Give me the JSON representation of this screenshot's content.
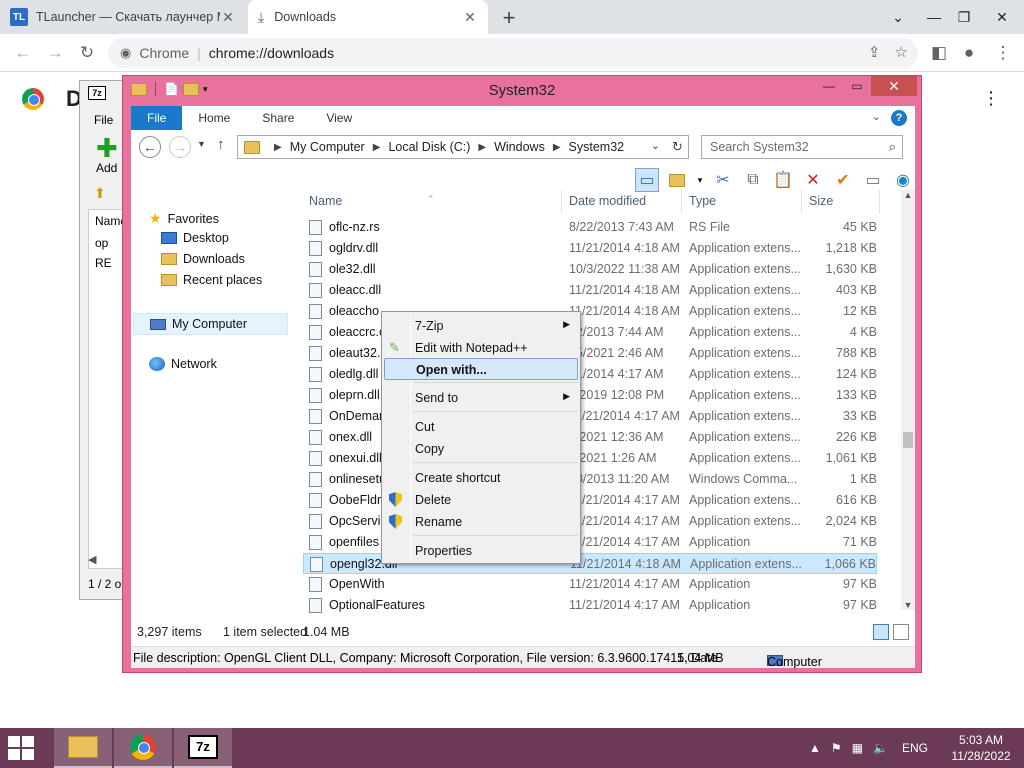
{
  "browser": {
    "tabs": [
      {
        "title": "TLauncher — Скачать лаунчер M",
        "favicon": "TL"
      },
      {
        "title": "Downloads"
      }
    ],
    "omnibox": {
      "origin": "Chrome",
      "url": "chrome://downloads"
    },
    "page_letter": "D"
  },
  "zip_window": {
    "title_icon": "7z",
    "menu_file": "File",
    "add_label": "Add",
    "column_name": "Name",
    "rows": [
      "op",
      "RE"
    ],
    "status": "1 / 2 o"
  },
  "explorer": {
    "title": "System32",
    "ribbon_tabs": [
      "File",
      "Home",
      "Share",
      "View"
    ],
    "breadcrumb": [
      "My Computer",
      "Local Disk (C:)",
      "Windows",
      "System32"
    ],
    "search_placeholder": "Search System32",
    "nav": {
      "favorites": "Favorites",
      "desktop": "Desktop",
      "downloads": "Downloads",
      "recent": "Recent places",
      "my_computer": "My Computer",
      "network": "Network"
    },
    "columns": {
      "name": "Name",
      "date": "Date modified",
      "type": "Type",
      "size": "Size"
    },
    "files": [
      {
        "name": "oflc-nz.rs",
        "date": "8/22/2013 7:43 AM",
        "type": "RS File",
        "size": "45 KB"
      },
      {
        "name": "ogldrv.dll",
        "date": "11/21/2014 4:18 AM",
        "type": "Application extens...",
        "size": "1,218 KB"
      },
      {
        "name": "ole32.dll",
        "date": "10/3/2022 11:38 AM",
        "type": "Application extens...",
        "size": "1,630 KB"
      },
      {
        "name": "oleacc.dll",
        "date": "11/21/2014 4:18 AM",
        "type": "Application extens...",
        "size": "403 KB"
      },
      {
        "name": "oleaccho",
        "date": "11/21/2014 4:18 AM",
        "type": "Application extens...",
        "size": "12 KB"
      },
      {
        "name": "oleaccrc.c",
        "date": "22/2013 7:44 AM",
        "type": "Application extens...",
        "size": "4 KB"
      },
      {
        "name": "oleaut32.c",
        "date": "15/2021 2:46 AM",
        "type": "Application extens...",
        "size": "788 KB"
      },
      {
        "name": "oledlg.dll",
        "date": "21/2014 4:17 AM",
        "type": "Application extens...",
        "size": "124 KB"
      },
      {
        "name": "oleprn.dll",
        "date": "9/2019 12:08 PM",
        "type": "Application extens...",
        "size": "133 KB"
      },
      {
        "name": "OnDemar",
        "date": "11/21/2014 4:17 AM",
        "type": "Application extens...",
        "size": "33 KB"
      },
      {
        "name": "onex.dll",
        "date": "9/2021 12:36 AM",
        "type": "Application extens...",
        "size": "226 KB"
      },
      {
        "name": "onexui.dll",
        "date": "9/2021 1:26 AM",
        "type": "Application extens...",
        "size": "1,061 KB"
      },
      {
        "name": "onlinesetu",
        "date": "18/2013 11:20 AM",
        "type": "Windows Comma...",
        "size": "1 KB"
      },
      {
        "name": "OobeFldr.",
        "date": "11/21/2014 4:17 AM",
        "type": "Application extens...",
        "size": "616 KB"
      },
      {
        "name": "OpcServic",
        "date": "11/21/2014 4:17 AM",
        "type": "Application extens...",
        "size": "2,024 KB"
      },
      {
        "name": "openfiles",
        "date": "11/21/2014 4:17 AM",
        "type": "Application",
        "size": "71 KB"
      },
      {
        "name": "opengl32.dll",
        "date": "11/21/2014 4:18 AM",
        "type": "Application extens...",
        "size": "1,066 KB",
        "selected": true
      },
      {
        "name": "OpenWith",
        "date": "11/21/2014 4:17 AM",
        "type": "Application",
        "size": "97 KB"
      },
      {
        "name": "OptionalFeatures",
        "date": "11/21/2014 4:17 AM",
        "type": "Application",
        "size": "97 KB"
      }
    ],
    "status": {
      "items": "3,297 items",
      "selected": "1 item selected",
      "size": "1.04 MB"
    },
    "details": {
      "description": "File description: OpenGL Client DLL, Company: Microsoft Corporation, File version: 6.3.9600.17415, Date",
      "size": "1.04 MB",
      "location": "Computer"
    }
  },
  "context_menu": {
    "items": [
      {
        "label": "7-Zip",
        "submenu": true
      },
      {
        "label": "Edit with Notepad++"
      },
      {
        "label": "Open with...",
        "highlighted": true
      },
      {
        "label": "Send to",
        "submenu": true
      },
      {
        "label": "Cut"
      },
      {
        "label": "Copy"
      },
      {
        "label": "Create shortcut"
      },
      {
        "label": "Delete"
      },
      {
        "label": "Rename"
      },
      {
        "label": "Properties"
      }
    ]
  },
  "taskbar": {
    "tray_lang": "ENG",
    "time": "5:03 AM",
    "date": "11/28/2022",
    "seven_zip_label": "7z"
  },
  "colors": {
    "explorer_frame": "#e8719e",
    "taskbar": "#6b3a56",
    "accent": "#1979ca",
    "selection": "#cce8ff"
  }
}
